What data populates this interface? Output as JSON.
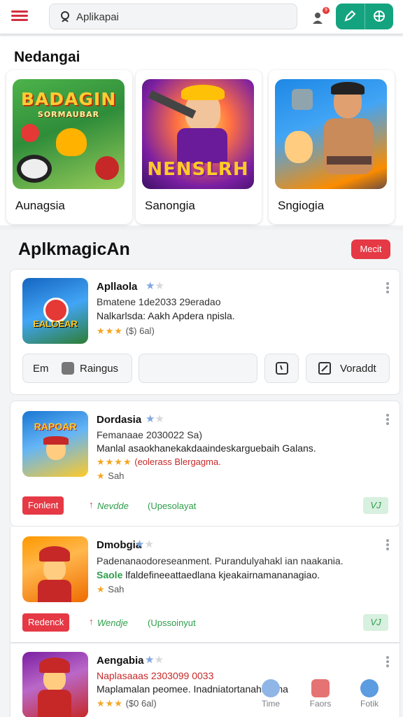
{
  "topbar": {
    "search_value": "Aplikapai",
    "notif_count": "9"
  },
  "featured": {
    "title": "Nedangai",
    "cards": [
      {
        "label": "Aunagsia",
        "logo": "BADAGIN",
        "sublogo": "SORMAUBAR"
      },
      {
        "label": "Sanongia",
        "logo": "NENSLRH",
        "sublogo": ""
      },
      {
        "label": "Sngiogia",
        "logo": "",
        "sublogo": ""
      }
    ]
  },
  "apps": {
    "title": "AplkmagicAn",
    "badge": "Mecit",
    "items": [
      {
        "name": "Apllaola",
        "meta": "Bmatene 1de2033 29eradao",
        "desc": "Nalkarlsda: Aakh Apdera npisla.",
        "rating": "($) 6al)",
        "buttons": {
          "left": "Em",
          "install": "Raingus",
          "right": "Voraddt"
        }
      },
      {
        "name": "Dordasia",
        "meta": "Femanaae 2030022 Sa)",
        "desc": "Manlal asaokhanekakdaaindeskarguebaih Galans.",
        "rating": "(eolerass Blergagma.",
        "rating2": "Sah",
        "tag_red": "Fonlent",
        "tag_g1": "Nevdde",
        "tag_g2": "(Upesolayat",
        "pill": "VJ"
      },
      {
        "name": "Dmobgia",
        "meta": "Padenanaodoreseanment. Purandulyahakl ian naakania.",
        "desc_red": "Saole",
        "desc": "lfaldefineeattaedlana kjeakairnamananagiao.",
        "rating": "Sah",
        "tag_red": "Redenck",
        "tag_g1": "Wendje",
        "tag_g2": "(Upssoinyut",
        "pill": "VJ"
      },
      {
        "name": "Aengabia",
        "meta": "Naplasaaas 2303099 0033",
        "desc": "Maplamalan peomee. Inadniatortanahabsha",
        "rating": "($0 6al)"
      }
    ]
  },
  "bottom_nav": [
    {
      "label": "Time"
    },
    {
      "label": "Faors"
    },
    {
      "label": "Fotik"
    }
  ],
  "colors": {
    "accent_red": "#e53945",
    "accent_green": "#14a37f",
    "star": "#f5a623"
  }
}
